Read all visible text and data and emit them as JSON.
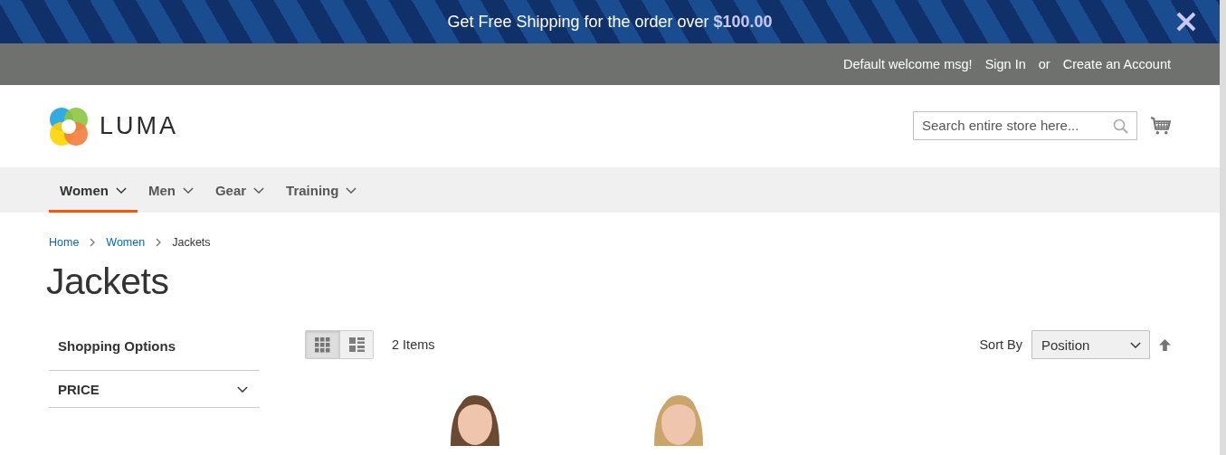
{
  "promo": {
    "text": "Get Free Shipping for the order over **$100.00**"
  },
  "panel": {
    "welcome": "Default welcome msg!",
    "links": [
      {
        "label": "Sign In"
      },
      {
        "label": "Create an Account"
      }
    ],
    "separator": "or"
  },
  "logo": {
    "name": "LUMA"
  },
  "search": {
    "placeholder": "Search entire store here..."
  },
  "nav": [
    {
      "label": "Women",
      "selected": true
    },
    {
      "label": "Men",
      "selected": false
    },
    {
      "label": "Gear",
      "selected": false
    },
    {
      "label": "Training",
      "selected": false
    }
  ],
  "breadcrumbs": [
    {
      "label": "Home",
      "kind": "link"
    },
    {
      "label": "Women",
      "kind": "link"
    },
    {
      "label": "Jackets",
      "kind": "current"
    }
  ],
  "page_title": "Jackets",
  "sidebar": {
    "title": "Shopping Options",
    "filters": [
      {
        "label": "PRICE",
        "expanded": false
      }
    ]
  },
  "toolbar": {
    "modes": [
      {
        "kind": "grid",
        "selected": true
      },
      {
        "kind": "list",
        "selected": false
      }
    ],
    "count": "2 Items",
    "sort_label": "Sort By",
    "sort_value": "Position"
  }
}
